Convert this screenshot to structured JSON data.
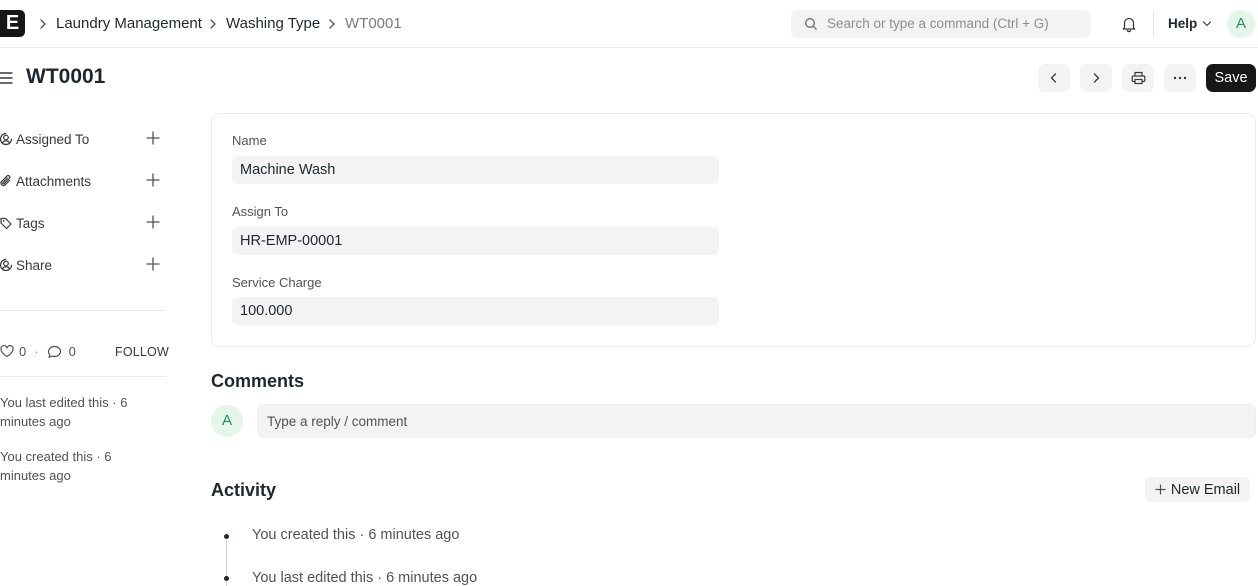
{
  "navbar": {
    "logo_letter": "E",
    "breadcrumbs": [
      "Laundry Management",
      "Washing Type",
      "WT0001"
    ],
    "search_placeholder": "Search or type a command (Ctrl + G)",
    "help_label": "Help",
    "user_initial": "A"
  },
  "page": {
    "title": "WT0001",
    "save_label": "Save"
  },
  "sidebar": {
    "items": [
      {
        "label": "Assigned To",
        "icon": "assign-icon"
      },
      {
        "label": "Attachments",
        "icon": "paperclip-icon"
      },
      {
        "label": "Tags",
        "icon": "tag-icon"
      },
      {
        "label": "Share",
        "icon": "share-icon"
      }
    ],
    "likes": "0",
    "stat_separator": "·",
    "comments_count": "0",
    "follow_label": "FOLLOW",
    "last_edited": "You last edited this · 6 minutes ago",
    "created": "You created this · 6 minutes ago"
  },
  "form": {
    "fields": [
      {
        "label": "Name",
        "value": "Machine Wash"
      },
      {
        "label": "Assign To",
        "value": "HR-EMP-00001"
      },
      {
        "label": "Service Charge",
        "value": "100.000"
      }
    ]
  },
  "comments": {
    "title": "Comments",
    "avatar_initial": "A",
    "placeholder": "Type a reply / comment"
  },
  "activity": {
    "title": "Activity",
    "new_email_label": "New Email",
    "items": [
      "You created this · 6 minutes ago",
      "You last edited this · 6 minutes ago"
    ]
  }
}
